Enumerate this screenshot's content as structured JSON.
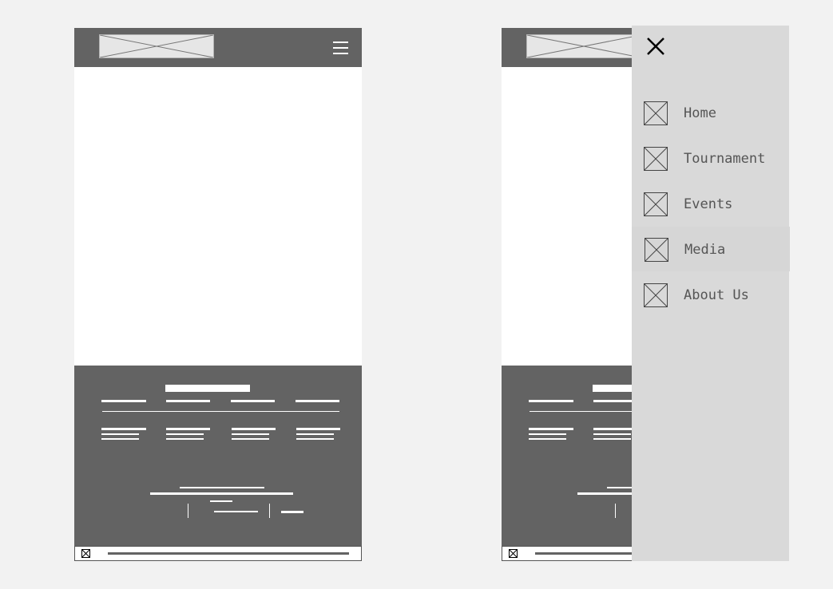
{
  "drawer": {
    "close_icon": "close-icon",
    "items": [
      {
        "label": "Home",
        "icon": "image-placeholder-icon"
      },
      {
        "label": "Tournament",
        "icon": "image-placeholder-icon"
      },
      {
        "label": "Events",
        "icon": "image-placeholder-icon"
      },
      {
        "label": "Media",
        "icon": "image-placeholder-icon"
      },
      {
        "label": "About Us",
        "icon": "image-placeholder-icon"
      }
    ]
  },
  "colors": {
    "page_background": "#f2f2f2",
    "header": "#636363",
    "footer": "#636363",
    "drawer": "#d9d9d9",
    "nav_text": "#555555"
  }
}
